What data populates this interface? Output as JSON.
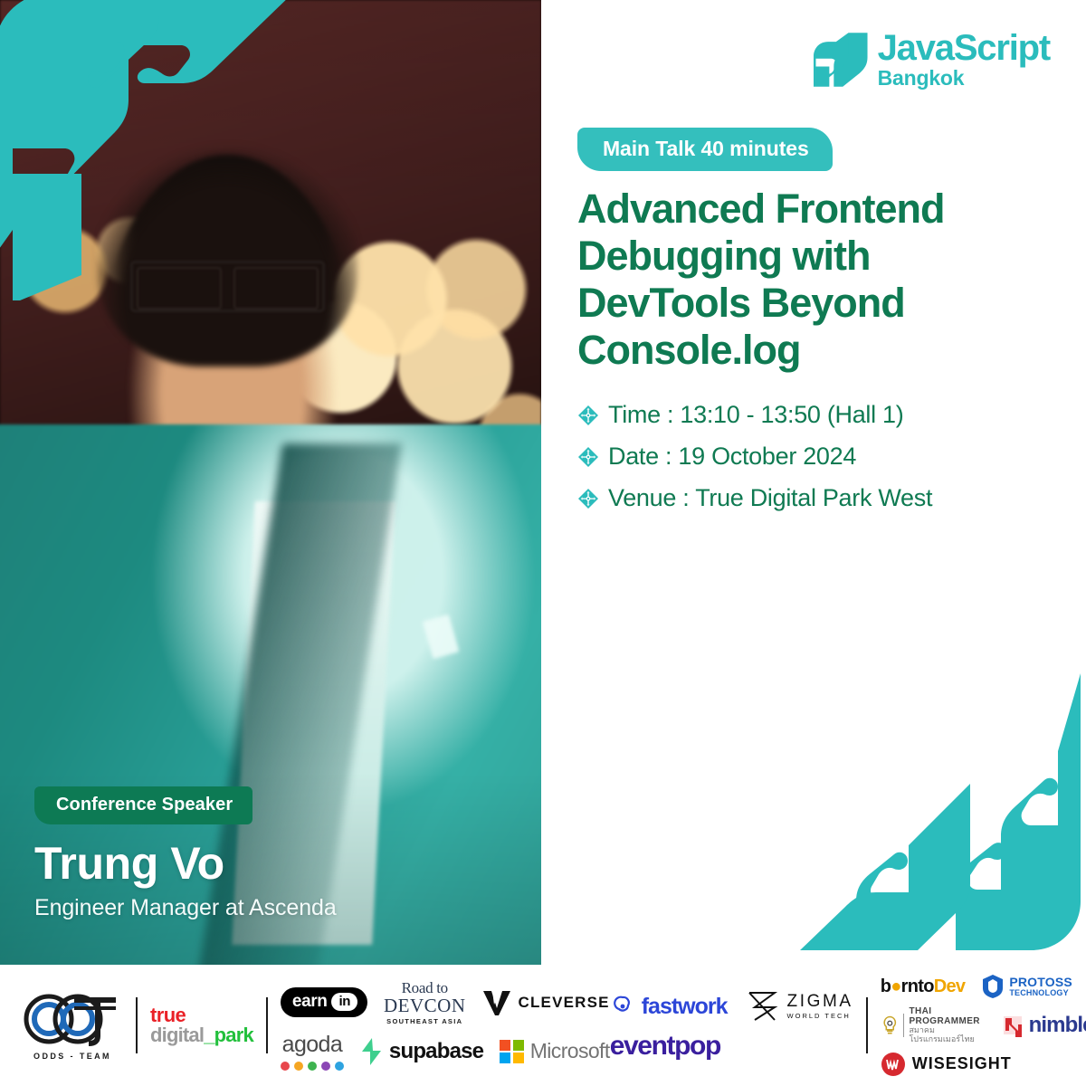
{
  "brand": {
    "title": "JavaScript",
    "subtitle": "Bangkok",
    "mark_icon": "js-mascot-icon",
    "color": "#2bbcbc"
  },
  "talk": {
    "badge": "Main Talk 40 minutes",
    "badge_color": "#34bfbd",
    "title": "Advanced Frontend Debugging with DevTools Beyond Console.log",
    "title_color": "#0f7a52",
    "details": [
      {
        "icon": "diamond-bullet-icon",
        "text": "Time : 13:10 - 13:50 (Hall 1)"
      },
      {
        "icon": "diamond-bullet-icon",
        "text": "Date : 19 October 2024"
      },
      {
        "icon": "diamond-bullet-icon",
        "text": "Venue : True Digital Park West"
      }
    ]
  },
  "speaker": {
    "badge": "Conference Speaker",
    "badge_color": "#0d7a54",
    "name": "Trung Vo",
    "role": "Engineer Manager at Ascenda",
    "photo_alt": "speaker-portrait"
  },
  "decor": {
    "top_left_mascot": "js-mascot-icon",
    "bottom_right_mascot": "js-mascot-icon"
  },
  "sponsors": {
    "group_1": [
      {
        "name": "ODDS-TEAM",
        "label": "ODDS - TEAM"
      },
      {
        "name": "True Digital Park",
        "line1": "true",
        "line2a": "digital",
        "line2b": "_park"
      }
    ],
    "group_2_row_1": [
      {
        "name": "earnin",
        "text": "earn",
        "pill": "in"
      },
      {
        "name": "Road to Devcon",
        "line1": "Road to",
        "line2": "DEVCON",
        "line3": "SOUTHEAST ASIA"
      },
      {
        "name": "Cleverse",
        "text": "CLEVERSE"
      }
    ],
    "group_2_row_2": [
      {
        "name": "agoda",
        "text": "agoda"
      },
      {
        "name": "supabase",
        "text": "supabase"
      },
      {
        "name": "Microsoft",
        "text": "Microsoft"
      }
    ],
    "group_3_row_1": [
      {
        "name": "fastwork",
        "text": "fastwork"
      },
      {
        "name": "ZIGMA",
        "line1": "ZIGMA",
        "line2": "WORLD TECH"
      }
    ],
    "group_3_row_2": [
      {
        "name": "eventpop",
        "text": "eventpop"
      }
    ],
    "group_4_row_1": [
      {
        "name": "borntoDev",
        "part1": "b",
        "part2": "rnt",
        "part3": "o",
        "part4": "Dev"
      },
      {
        "name": "Protoss Technology",
        "line1": "PROTOSS",
        "line2": "TECHNOLOGY"
      }
    ],
    "group_4_row_2": [
      {
        "name": "Thai Programmer",
        "line1": "THAI PROGRAMMER",
        "line2": "สมาคมโปรแกรมเมอร์ไทย"
      },
      {
        "name": "nimble",
        "text": "nimble"
      }
    ],
    "group_4_row_3": [
      {
        "name": "Wisesight",
        "text": "WISESIGHT"
      }
    ]
  }
}
